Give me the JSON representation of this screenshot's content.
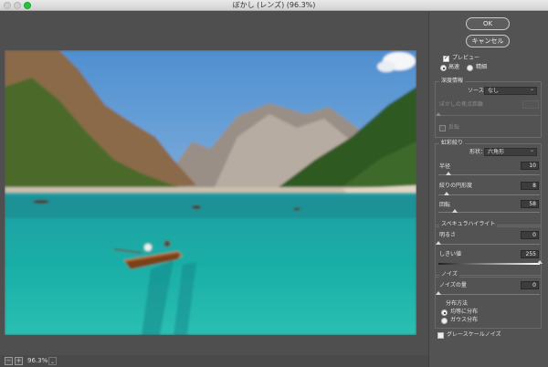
{
  "window": {
    "title": "ぼかし (レンズ) (96.3%)"
  },
  "buttons": {
    "ok": "OK",
    "cancel": "キャンセル"
  },
  "preview": {
    "label": "プレビュー",
    "checked": true,
    "quality_fast": "高速",
    "quality_accurate": "精細"
  },
  "depth_map": {
    "title": "深度情報",
    "source_label": "ソース：",
    "source_value": "なし",
    "focal_distance_label": "ぼかしの焦点距離",
    "invert_label": "反転"
  },
  "iris": {
    "title": "虹彩絞り",
    "shape_label": "形状：",
    "shape_value": "六角形",
    "radius_label": "半径",
    "radius_value": "10",
    "curvature_label": "絞りの円形度",
    "curvature_value": "8",
    "rotation_label": "回転",
    "rotation_value": "58"
  },
  "specular": {
    "title": "スペキュラハイライト",
    "brightness_label": "明るさ",
    "brightness_value": "0",
    "threshold_label": "しきい値",
    "threshold_value": "255"
  },
  "noise": {
    "title": "ノイズ",
    "amount_label": "ノイズの量",
    "amount_value": "0",
    "distribution_label": "分布方法",
    "uniform_label": "均等に分布",
    "gaussian_label": "ガウス分布",
    "monochrome_label": "グレースケールノイズ"
  },
  "status": {
    "zoom_out": "−",
    "zoom_in": "+",
    "zoom_value": "96.3%"
  },
  "slider_levels": {
    "radius": 0.1,
    "curvature": 0.08,
    "rotation": 0.16,
    "brightness": 0.0,
    "threshold": 1.0,
    "noise": 0.0
  },
  "icons": {
    "close": "window-close-icon",
    "minimize": "window-minimize-icon",
    "maximize": "window-maximize-icon",
    "dropdown": "chevron-down-icon"
  },
  "colors": {
    "window_bg": "#4d4d4d",
    "panel_bg": "#535353",
    "lake": "#1aa9a6",
    "sky": "#6fa9db"
  }
}
